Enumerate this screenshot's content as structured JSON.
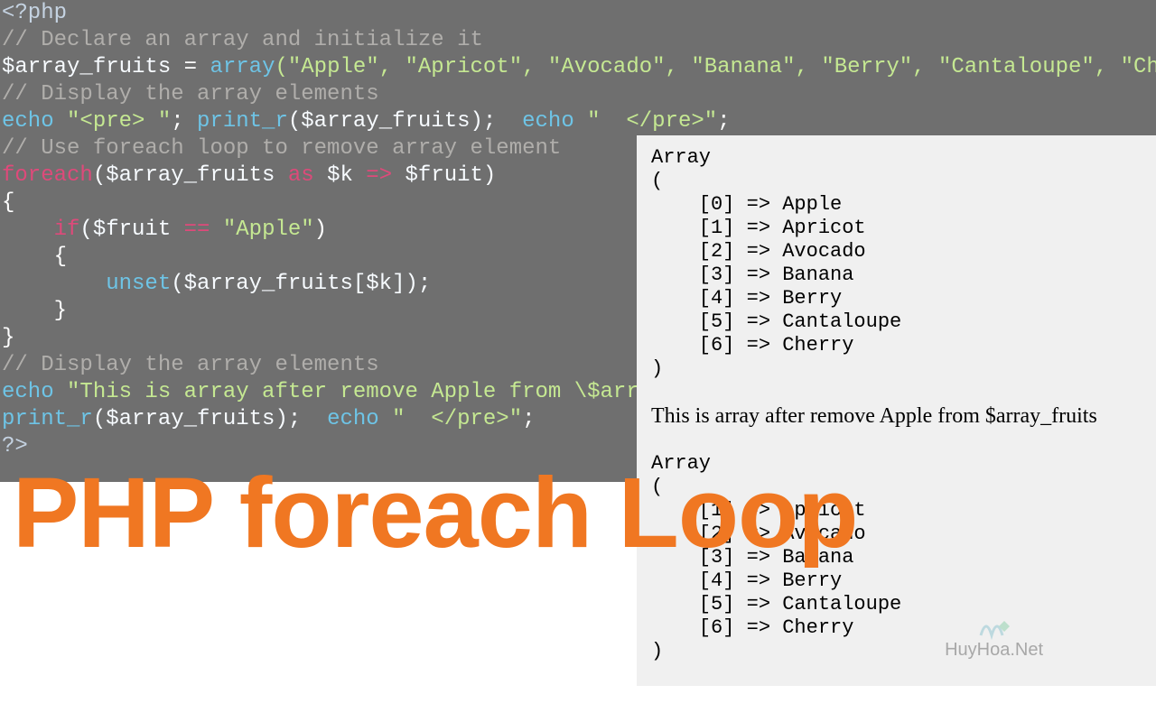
{
  "code": {
    "l1": "<?php",
    "l2": "// Declare an array and initialize it",
    "l3_var": "$array_fruits",
    "l3_op": " = ",
    "l3_fn": "array",
    "l3_args": "(\"Apple\", \"Apricot\", \"Avocado\", \"Banana\", \"Berry\", \"Cantaloupe\", \"Cherry\"",
    "l4": "// Display the array elements",
    "l5a": "echo",
    "l5b": " \"<pre> \"",
    "l5c": "; ",
    "l5d": "print_r",
    "l5e": "($array_fruits);  ",
    "l5f": "echo",
    "l5g": " \"  </pre>\"",
    "l5h": ";",
    "l6": "// Use foreach loop to remove array element",
    "l7a": "foreach",
    "l7b": "($array_fruits ",
    "l7c": "as",
    "l7d": " $k ",
    "l7e": "=>",
    "l7f": " $fruit)",
    "l8": "{",
    "l9a": "    if",
    "l9b": "($fruit ",
    "l9c": "==",
    "l9d": " \"Apple\"",
    "l9e": ")",
    "l10": "    {",
    "l11a": "        unset",
    "l11b": "($array_fruits[$k]);",
    "l12": "    }",
    "l13": "}",
    "l14": "// Display the array elements",
    "l15a": "echo",
    "l15b": " \"This is array after remove Apple from \\$array_fruits <pre> \"",
    "l15c": ";",
    "l16a": "print_r",
    "l16b": "($array_fruits);  ",
    "l16c": "echo",
    "l16d": " \"  </pre>\"",
    "l16e": ";",
    "l17": "",
    "l18": "?>"
  },
  "output": {
    "arr_header": "Array",
    "open_paren": "(",
    "items1": [
      "    [0] => Apple",
      "    [1] => Apricot",
      "    [2] => Avocado",
      "    [3] => Banana",
      "    [4] => Berry",
      "    [5] => Cantaloupe",
      "    [6] => Cherry"
    ],
    "close_paren": ")",
    "message": "This is array after remove Apple from $array_fruits",
    "items2": [
      "    [1] => Apricot",
      "    [2] => Avocado",
      "    [3] => Banana",
      "    [4] => Berry",
      "    [5] => Cantaloupe",
      "    [6] => Cherry"
    ]
  },
  "title": "PHP foreach Loop",
  "watermark": "HuyHoa.Net"
}
